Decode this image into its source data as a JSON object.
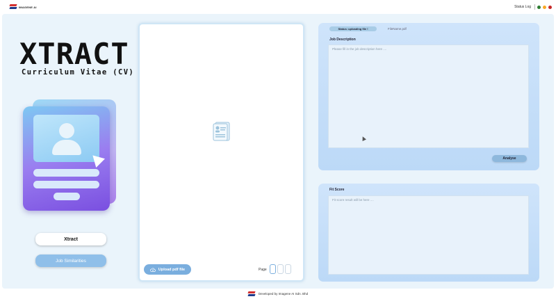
{
  "topbar": {
    "brand": "IMAGENE AI",
    "status_log": "Status Log",
    "window_dots": [
      "#2e7d32",
      "#f9a825",
      "#c62828"
    ]
  },
  "brand": {
    "title": "Xtract",
    "subtitle": "Curriculum Vitae (CV)"
  },
  "nav": {
    "xtract_button": "Xtract",
    "job_similarities_button": "Job Similarities"
  },
  "viewer": {
    "upload_button": "Upload pdf file",
    "page_label": "Page",
    "page_boxes": 3
  },
  "job_description": {
    "status_tab": "Status: uploading file !",
    "file_name": "FileName.pdf",
    "label": "Job Description",
    "placeholder": "Please fill in the job description here ....",
    "analyse_button": "Analyse"
  },
  "fit_score": {
    "label": "Fit Score",
    "placeholder": "Fit score result will be here ...."
  },
  "footer": {
    "text": "Developed by Imagene AI Sdn. Bhd"
  },
  "colors": {
    "accent": "#7aaede",
    "panel": "#cfe4fb",
    "background": "#eaf4fb"
  }
}
